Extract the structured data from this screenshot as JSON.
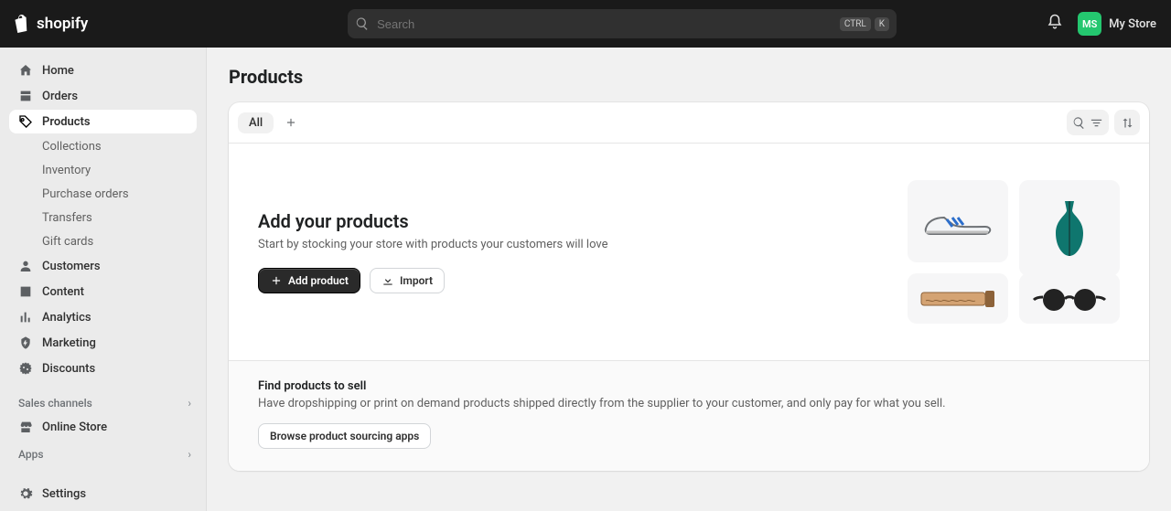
{
  "header": {
    "brand": "shopify",
    "search_placeholder": "Search",
    "kbd1": "CTRL",
    "kbd2": "K",
    "store_initials": "MS",
    "store_name": "My Store"
  },
  "sidebar": {
    "main": [
      {
        "label": "Home"
      },
      {
        "label": "Orders"
      },
      {
        "label": "Products"
      },
      {
        "label": "Customers"
      },
      {
        "label": "Content"
      },
      {
        "label": "Analytics"
      },
      {
        "label": "Marketing"
      },
      {
        "label": "Discounts"
      }
    ],
    "products_sub": [
      {
        "label": "Collections"
      },
      {
        "label": "Inventory"
      },
      {
        "label": "Purchase orders"
      },
      {
        "label": "Transfers"
      },
      {
        "label": "Gift cards"
      }
    ],
    "section_channels": "Sales channels",
    "channel_items": [
      {
        "label": "Online Store"
      }
    ],
    "section_apps": "Apps",
    "settings": "Settings"
  },
  "page": {
    "title": "Products",
    "tab_all": "All",
    "empty": {
      "heading": "Add your products",
      "subtext": "Start by stocking your store with products your customers will love",
      "add_btn": "Add product",
      "import_btn": "Import"
    },
    "find": {
      "heading": "Find products to sell",
      "subtext": "Have dropshipping or print on demand products shipped directly from the supplier to your customer, and only pay for what you sell.",
      "browse_btn": "Browse product sourcing apps"
    }
  }
}
